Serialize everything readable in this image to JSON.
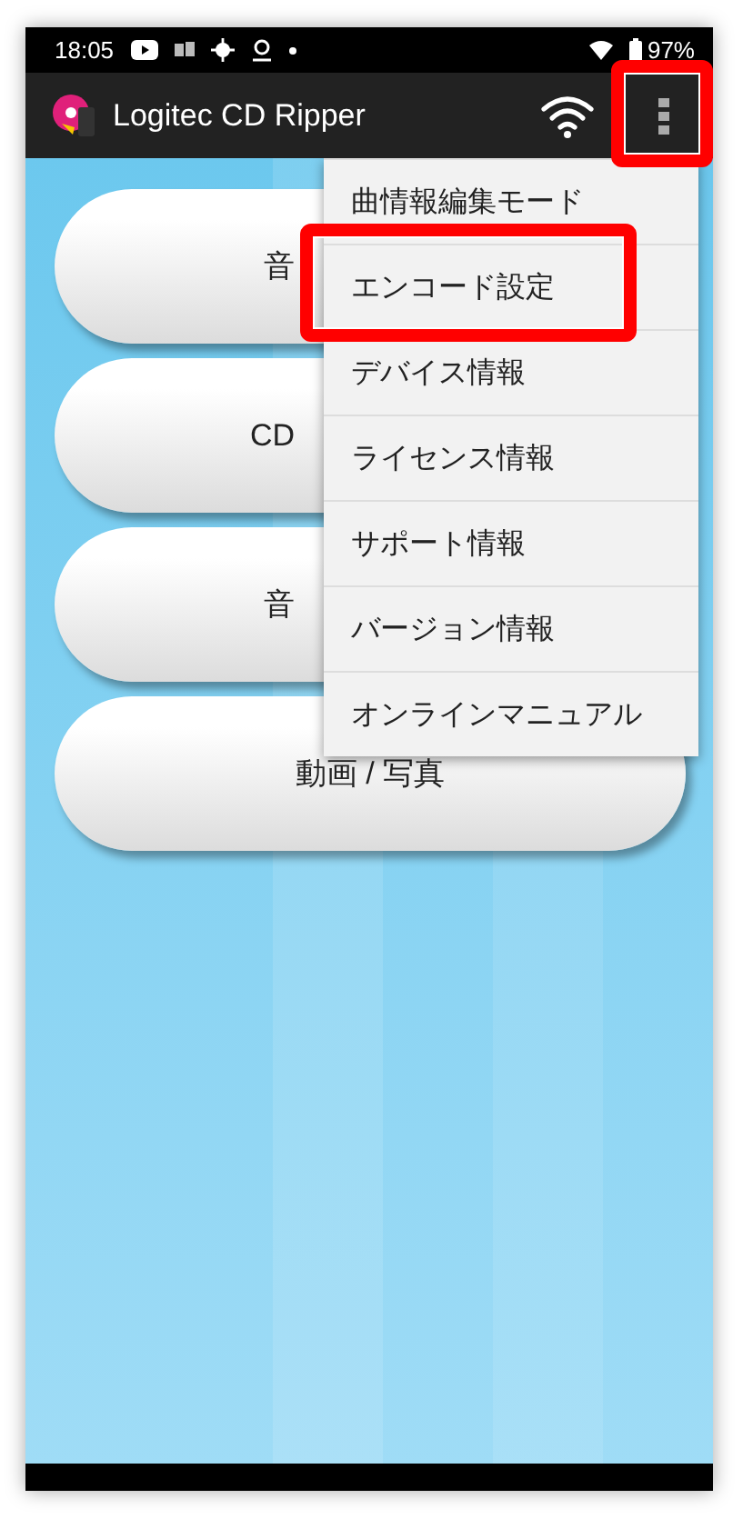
{
  "status_bar": {
    "time": "18:05",
    "battery": "97%"
  },
  "app_bar": {
    "title": "Logitec CD Ripper",
    "menu_button": {
      "highlighted": true
    }
  },
  "main_buttons": [
    {
      "label": "音",
      "kind": "cut"
    },
    {
      "label": "CD",
      "kind": "cut"
    },
    {
      "label": "音",
      "kind": "cut"
    },
    {
      "label": "動画 / 写真",
      "kind": "full"
    }
  ],
  "overflow_menu": {
    "items": [
      {
        "label": "曲情報編集モード",
        "highlighted": false
      },
      {
        "label": "エンコード設定",
        "highlighted": true
      },
      {
        "label": "デバイス情報",
        "highlighted": false
      },
      {
        "label": "ライセンス情報",
        "highlighted": false
      },
      {
        "label": "サポート情報",
        "highlighted": false
      },
      {
        "label": "バージョン情報",
        "highlighted": false
      },
      {
        "label": "オンラインマニュアル",
        "highlighted": false
      }
    ]
  }
}
